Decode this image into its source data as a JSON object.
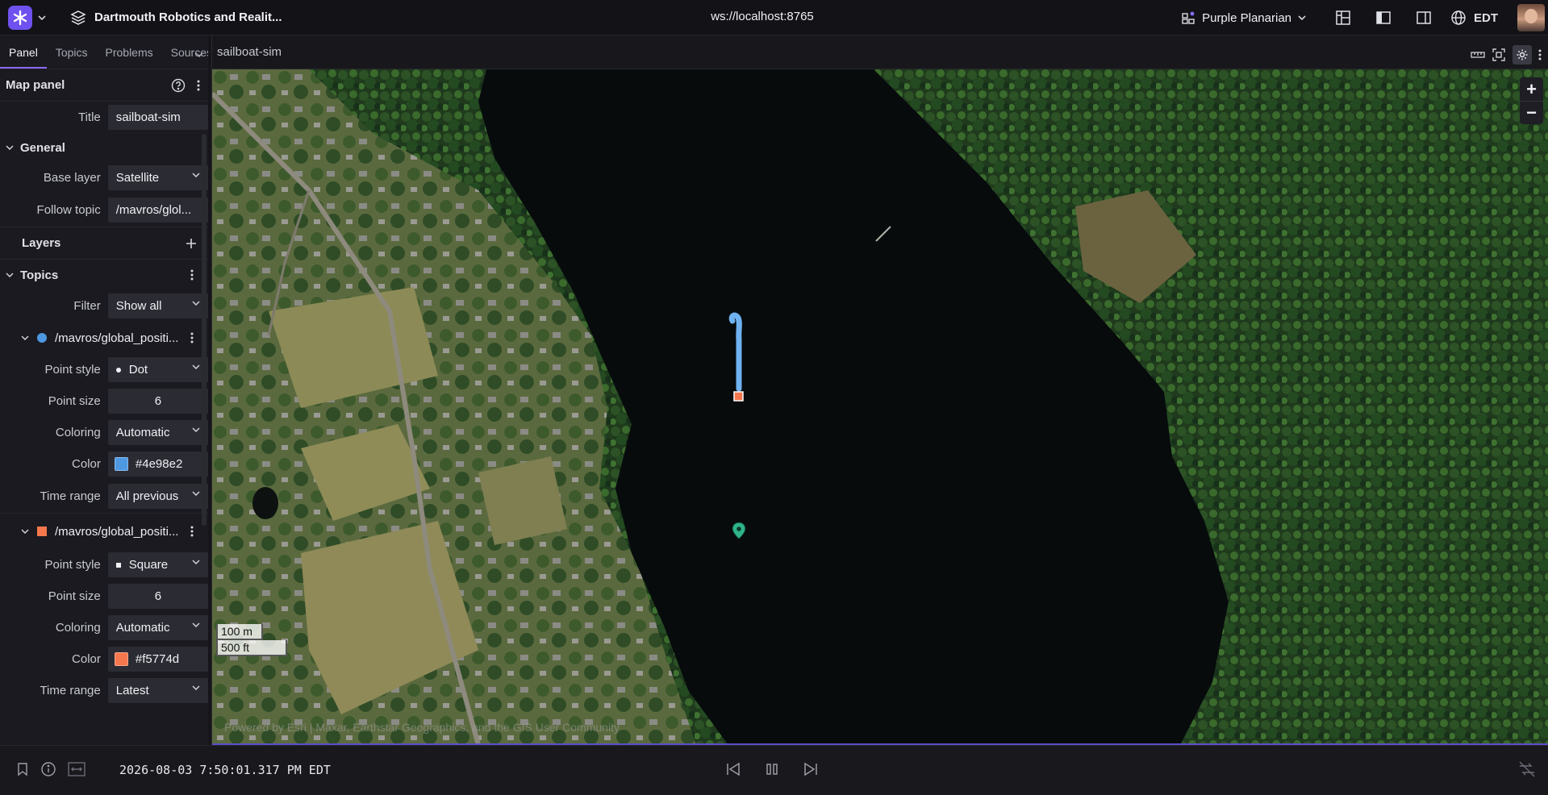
{
  "appbar": {
    "layout_name": "Dartmouth Robotics and Realit...",
    "connection": "ws://localhost:8765",
    "user_name": "Purple Planarian",
    "timezone": "EDT"
  },
  "sidebar": {
    "tabs": [
      "Panel",
      "Topics",
      "Problems",
      "Sources"
    ],
    "panel_heading": "Map panel",
    "title_label": "Title",
    "title_value": "sailboat-sim",
    "general": {
      "heading": "General",
      "base_layer_label": "Base layer",
      "base_layer_value": "Satellite",
      "follow_topic_label": "Follow topic",
      "follow_topic_value": "/mavros/glol..."
    },
    "layers_heading": "Layers",
    "topics_heading": "Topics",
    "filter_label": "Filter",
    "filter_value": "Show all",
    "topics": [
      {
        "name": "/mavros/global_positi...",
        "color_hex": "#4e98e2",
        "point_style_label": "Point style",
        "point_style": "Dot",
        "point_size_label": "Point size",
        "point_size": "6",
        "coloring_label": "Coloring",
        "coloring": "Automatic",
        "color_label": "Color",
        "color": "#4e98e2",
        "time_range_label": "Time range",
        "time_range": "All previous"
      },
      {
        "name": "/mavros/global_positi...",
        "color_hex": "#f5774d",
        "point_style_label": "Point style",
        "point_style": "Square",
        "point_size_label": "Point size",
        "point_size": "6",
        "coloring_label": "Coloring",
        "coloring": "Automatic",
        "color_label": "Color",
        "color": "#f5774d",
        "time_range_label": "Time range",
        "time_range": "Latest"
      }
    ]
  },
  "panel": {
    "title": "sailboat-sim",
    "scale_metric": "100 m",
    "scale_imperial": "500 ft",
    "attribution": "Powered by Esri | Maxar, Earthstar Geographics, and the GIS User Community"
  },
  "playback": {
    "timestamp": "2026-08-03 7:50:01.317 PM EDT"
  },
  "colors": {
    "accent": "#6e51ee",
    "track": "#4e98e2",
    "latest": "#f5774d",
    "marker": "#2fb38a"
  }
}
